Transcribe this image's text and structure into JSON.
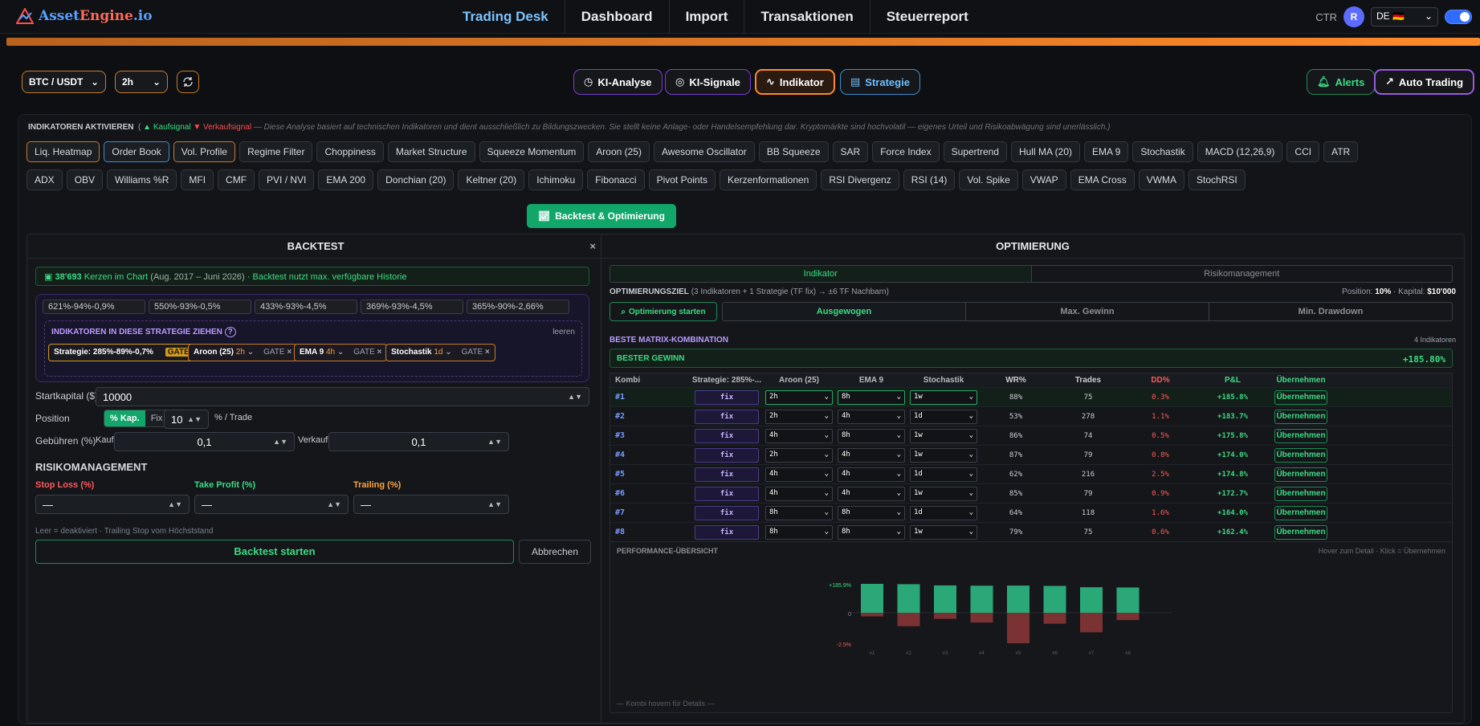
{
  "app": {
    "brand_a": "Asset",
    "brand_b": "Engine",
    "brand_c": ".io"
  },
  "nav": [
    "Trading Desk",
    "Dashboard",
    "Import",
    "Transaktionen",
    "Steuerreport"
  ],
  "topright": {
    "ctr": "CTR",
    "avatar": "R",
    "lang": "DE 🇩🇪"
  },
  "toolbar": {
    "pair": "BTC / USDT",
    "tf": "2h",
    "ki_analyse": "KI-Analyse",
    "ki_signale": "KI-Signale",
    "indikator": "Indikator",
    "strategie": "Strategie",
    "alerts": "Alerts",
    "auto": "Auto Trading"
  },
  "ind": {
    "head": "INDIKATOREN AKTIVIEREN",
    "buy": "▲ Kaufsignal",
    "sell": "▼ Verkaufsignal",
    "disclaimer": "— Diese Analyse basiert auf technischen Indikatoren und dient ausschließlich zu Bildungszwecken. Sie stellt keine Anlage- oder Handelsempfehlung dar. Kryptomärkte sind hochvolatil — eigenes Urteil und Risikoabwägung sind unerlässlich.)",
    "row1": [
      "Liq. Heatmap",
      "Order Book",
      "Vol. Profile",
      "Regime Filter",
      "Choppiness",
      "Market Structure",
      "Squeeze Momentum",
      "Aroon (25)",
      "Awesome Oscillator",
      "BB Squeeze",
      "SAR",
      "Force Index",
      "Supertrend",
      "Hull MA (20)",
      "EMA 9",
      "Stochastik",
      "MACD (12,26,9)",
      "CCI",
      "ATR"
    ],
    "row2": [
      "ADX",
      "OBV",
      "Williams %R",
      "MFI",
      "CMF",
      "PVI / NVI",
      "EMA 200",
      "Donchian (20)",
      "Keltner (20)",
      "Ichimoku",
      "Fibonacci",
      "Pivot Points",
      "Kerzenformationen",
      "RSI Divergenz",
      "RSI (14)",
      "Vol. Spike",
      "VWAP",
      "EMA Cross",
      "VWMA",
      "StochRSI"
    ]
  },
  "backtest_btn": "Backtest & Optimierung",
  "backtest": {
    "title": "BACKTEST",
    "close": "×",
    "count": "38'693",
    "count_label": "Kerzen im Chart",
    "range": "(Aug. 2017 – Juni 2026)",
    "info": "· Backtest nutzt max. verfügbare Historie",
    "saved": [
      "621%-94%-0,9%",
      "550%-93%-0,5%",
      "433%-93%-4,5%",
      "369%-93%-4,5%",
      "365%-90%-2,66%"
    ],
    "drop_title": "INDIKATOREN IN DIESE STRATEGIE ZIEHEN",
    "drop_clear": "leeren",
    "drop": [
      {
        "name": "Strategie: 285%-89%-0,7%",
        "tf": "",
        "gate": "GATE"
      },
      {
        "name": "Aroon (25)",
        "tf": "2h",
        "gate": "GATE"
      },
      {
        "name": "EMA 9",
        "tf": "4h",
        "gate": "GATE"
      },
      {
        "name": "Stochastik",
        "tf": "1d",
        "gate": "GATE"
      }
    ],
    "start_label": "Startkapital ($)",
    "start_value": "10000",
    "pos_label": "Position",
    "pos_pct": "% Kap.",
    "pos_fix": "Fix $",
    "pos_value": "10",
    "pos_unit": "% / Trade",
    "fee_label": "Gebühren (%)",
    "buy_label": "Kauf",
    "buy_value": "0,1",
    "sell_label": "Verkauf",
    "sell_value": "0,1",
    "risk_title": "RISIKOMANAGEMENT",
    "sl": "Stop Loss (%)",
    "tp": "Take Profit (%)",
    "trail": "Trailing (%)",
    "empty": "—",
    "note": "Leer = deaktiviert · Trailing Stop vom Höchststand",
    "start_btn": "Backtest starten",
    "cancel_btn": "Abbrechen"
  },
  "opt": {
    "title": "OPTIMIERUNG",
    "tab1": "Indikator",
    "tab2": "Risikomanagement",
    "goal_label": "OPTIMIERUNGSZIEL",
    "goal_detail": "(3 Indikatoren + 1 Strategie (TF fix) → ±6 TF Nachbarn)",
    "pos_text": "Position:",
    "pos_val": "10%",
    "cap_text": "· Kapital:",
    "cap_val": "$10'000",
    "start": "Optimierung starten",
    "goals": [
      "Ausgewogen",
      "Max. Gewinn",
      "Min. Drawdown"
    ],
    "best_title": "BESTE MATRIX-KOMBINATION",
    "best_count": "4 Indikatoren",
    "best_label": "BESTER GEWINN",
    "best_value": "+185.80%",
    "headers": [
      "Kombi",
      "Strategie: 285%-...",
      "Aroon (25)",
      "EMA 9",
      "Stochastik",
      "WR%",
      "Trades",
      "DD%",
      "P&L",
      "Übernehmen"
    ],
    "rows": [
      {
        "k": "#1",
        "s": "fix",
        "a": "2h",
        "e": "8h",
        "st": "1w",
        "wr": "88%",
        "tr": "75",
        "dd": "0.3%",
        "pl": "+185.8%",
        "btn": "Übernehmen"
      },
      {
        "k": "#2",
        "s": "fix",
        "a": "2h",
        "e": "4h",
        "st": "1d",
        "wr": "53%",
        "tr": "278",
        "dd": "1.1%",
        "pl": "+183.7%",
        "btn": "Übernehmen"
      },
      {
        "k": "#3",
        "s": "fix",
        "a": "4h",
        "e": "8h",
        "st": "1w",
        "wr": "86%",
        "tr": "74",
        "dd": "0.5%",
        "pl": "+175.8%",
        "btn": "Übernehmen"
      },
      {
        "k": "#4",
        "s": "fix",
        "a": "2h",
        "e": "4h",
        "st": "1w",
        "wr": "87%",
        "tr": "79",
        "dd": "0.8%",
        "pl": "+174.0%",
        "btn": "Übernehmen"
      },
      {
        "k": "#5",
        "s": "fix",
        "a": "4h",
        "e": "4h",
        "st": "1d",
        "wr": "62%",
        "tr": "216",
        "dd": "2.5%",
        "pl": "+174.8%",
        "btn": "Übernehmen"
      },
      {
        "k": "#6",
        "s": "fix",
        "a": "4h",
        "e": "4h",
        "st": "1w",
        "wr": "85%",
        "tr": "79",
        "dd": "0.9%",
        "pl": "+172.7%",
        "btn": "Übernehmen"
      },
      {
        "k": "#7",
        "s": "fix",
        "a": "8h",
        "e": "8h",
        "st": "1d",
        "wr": "64%",
        "tr": "118",
        "dd": "1.6%",
        "pl": "+164.0%",
        "btn": "Übernehmen"
      },
      {
        "k": "#8",
        "s": "fix",
        "a": "8h",
        "e": "8h",
        "st": "1w",
        "wr": "79%",
        "tr": "75",
        "dd": "0.6%",
        "pl": "+162.4%",
        "btn": "Übernehmen"
      }
    ],
    "perf_title": "PERFORMANCE-ÜBERSICHT",
    "perf_hint": "Hover zum Detail · Klick = Übernehmen",
    "perf_foot": "— Kombi hovern für Details —"
  },
  "chart_data": {
    "type": "bar",
    "categories": [
      "#1",
      "#2",
      "#3",
      "#4",
      "#5",
      "#6",
      "#7",
      "#8"
    ],
    "series": [
      {
        "values": [
          185.8,
          183.7,
          175.8,
          174.0,
          174.8,
          172.7,
          164.0,
          162.4
        ]
      },
      {
        "values": [
          -0.3,
          -1.1,
          -0.5,
          -0.8,
          -2.5,
          -0.9,
          -1.6,
          -0.6
        ]
      }
    ],
    "ytick_top": "+185.9%",
    "ytick_zero": "0",
    "ytick_bottom": "-2.5%",
    "colors": {
      "pos": "#2aa878",
      "neg": "#7a3232"
    }
  }
}
